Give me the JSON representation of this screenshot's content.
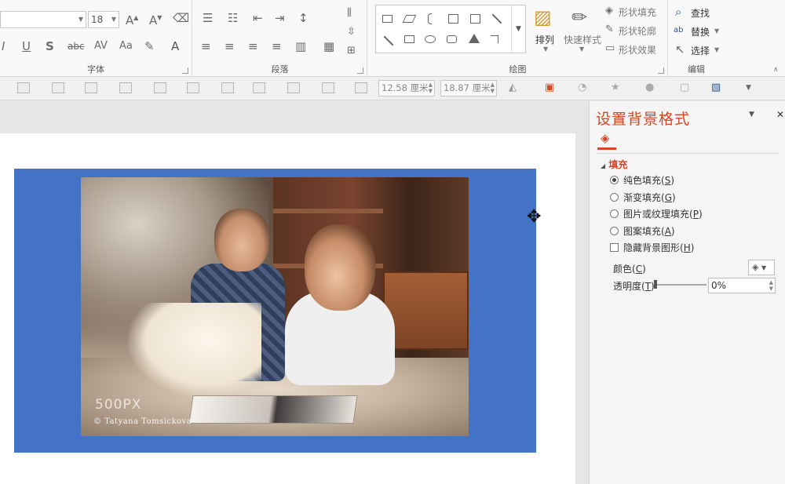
{
  "ribbon": {
    "font_group": {
      "label": "字体",
      "font_size": "18"
    },
    "paragraph_group": {
      "label": "段落"
    },
    "drawing_group": {
      "label": "绘图",
      "arrange_label": "排列",
      "quick_styles_label": "快速样式",
      "shape_fill_label": "形状填充",
      "shape_outline_label": "形状轮廓",
      "shape_effects_label": "形状效果"
    },
    "editing_group": {
      "label": "编辑",
      "find_label": "查找",
      "replace_label": "替换",
      "select_label": "选择"
    }
  },
  "format_bar": {
    "height_value": "12.58 厘米",
    "width_value": "18.87 厘米"
  },
  "slide": {
    "background_color": "#4472c4",
    "photo_watermark": "500PX",
    "photo_credit": "© Tatyana Tomsickova"
  },
  "format_pane": {
    "title": "设置背景格式",
    "section": "填充",
    "fill_options": [
      {
        "label": "纯色填充",
        "key": "S",
        "selected": true
      },
      {
        "label": "渐变填充",
        "key": "G",
        "selected": false
      },
      {
        "label": "图片或纹理填充",
        "key": "P",
        "selected": false
      },
      {
        "label": "图案填充",
        "key": "A",
        "selected": false
      }
    ],
    "hide_graphics": {
      "label": "隐藏背景图形",
      "key": "H",
      "checked": false
    },
    "color_label": "颜色",
    "color_key": "C",
    "transparency_label": "透明度",
    "transparency_key": "T",
    "transparency_value": "0%"
  },
  "accent_color": "#d24726"
}
